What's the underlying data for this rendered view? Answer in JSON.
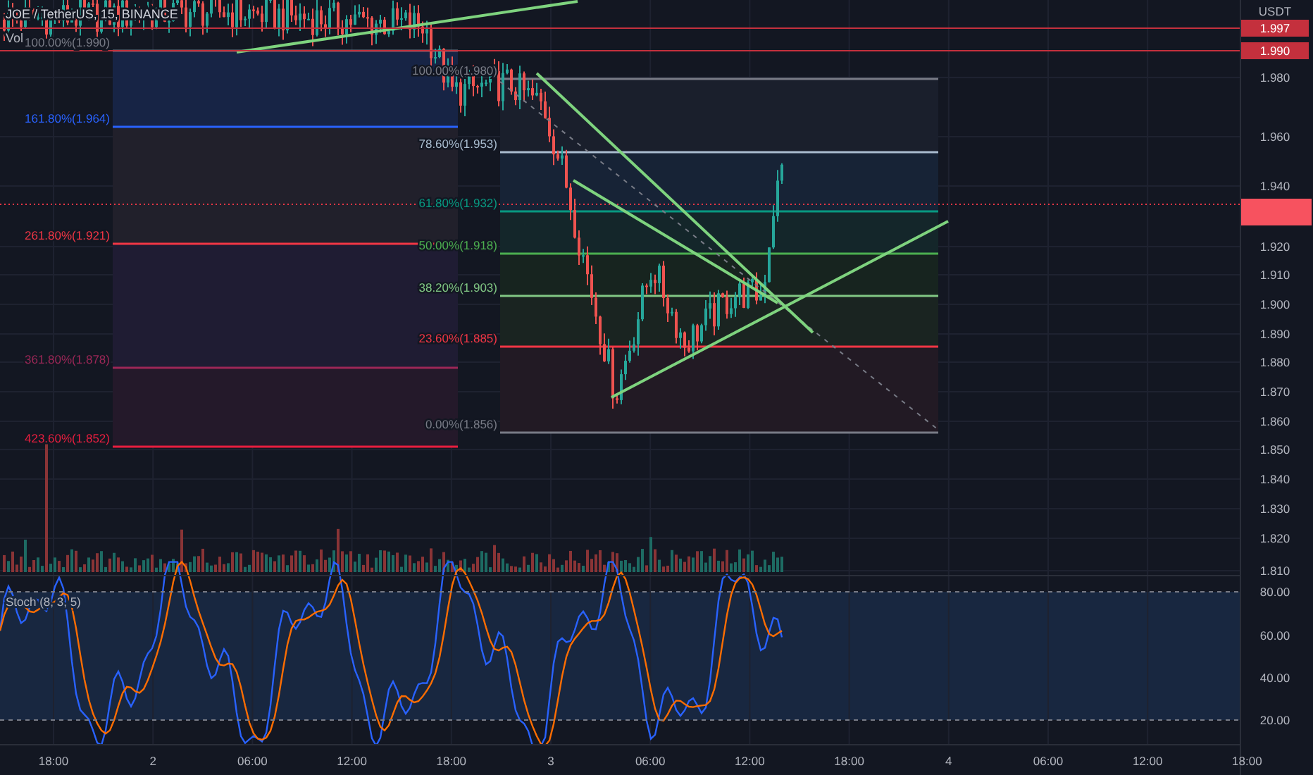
{
  "legend": {
    "symbol": "JOE / TetherUS, 15, BINANCE",
    "volume": "Vol"
  },
  "price_axis": {
    "unit": "USDT",
    "ticks": [
      "1.980",
      "1.960",
      "1.940",
      "1.920",
      "1.910",
      "1.900",
      "1.890",
      "1.880",
      "1.870",
      "1.860",
      "1.850",
      "1.840",
      "1.830",
      "1.820",
      "1.810"
    ],
    "alert_badges": [
      "1.997",
      "1.990"
    ]
  },
  "fib_extension": [
    {
      "label": "100.00%(1.990)",
      "color": "#787b86"
    },
    {
      "label": "161.80%(1.964)",
      "color": "#2962ff"
    },
    {
      "label": "261.80%(1.921)",
      "color": "#f23645"
    },
    {
      "label": "361.80%(1.878)",
      "color": "#9c2757"
    },
    {
      "label": "423.60%(1.852)",
      "color": "#e91e3f"
    }
  ],
  "fib_retracement": [
    {
      "label": "100.00%(1.980)",
      "color": "#787b86"
    },
    {
      "label": "78.60%(1.953)",
      "color": "#a9bccf"
    },
    {
      "label": "61.80%(1.932)",
      "color": "#089981"
    },
    {
      "label": "50.00%(1.918)",
      "color": "#4caf50"
    },
    {
      "label": "38.20%(1.903)",
      "color": "#81c784"
    },
    {
      "label": "23.60%(1.885)",
      "color": "#f23645"
    },
    {
      "label": "0.00%(1.856)",
      "color": "#787b86"
    }
  ],
  "stochastic": {
    "title": "Stoch (8, 3, 5)",
    "ticks": [
      "80.00",
      "60.00",
      "40.00",
      "20.00"
    ]
  },
  "time_axis": [
    "18:00",
    "2",
    "06:00",
    "12:00",
    "18:00",
    "3",
    "06:00",
    "12:00",
    "18:00",
    "4",
    "06:00",
    "12:00",
    "18:00"
  ]
}
